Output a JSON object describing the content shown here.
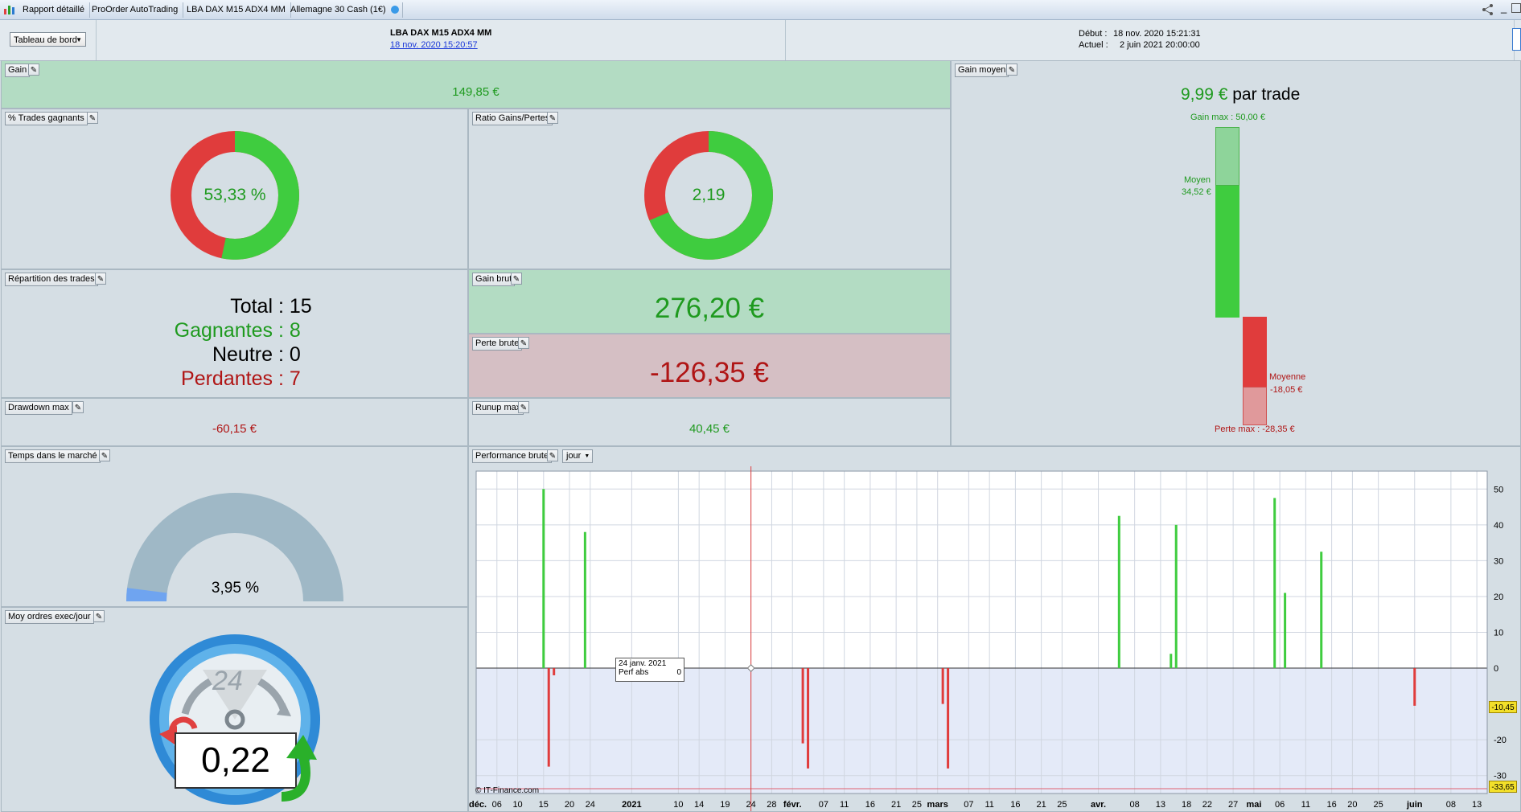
{
  "tabs": [
    {
      "label": "Rapport détaillé"
    },
    {
      "label": "ProOrder AutoTrading"
    },
    {
      "label": "LBA DAX M15 ADX4 MM"
    },
    {
      "label": "Allemagne 30 Cash (1€)"
    }
  ],
  "header": {
    "dashboard_select": "Tableau de bord",
    "strategy_name": "LBA DAX M15 ADX4 MM",
    "strategy_date_link": "18 nov. 2020 15:20:57",
    "debut_label": "Début :",
    "debut_value": "18 nov. 2020 15:21:31",
    "actuel_label": "Actuel :",
    "actuel_value": "2 juin 2021 20:00:00"
  },
  "gain": {
    "title": "Gain",
    "value": "149,85 €"
  },
  "gain_moyen": {
    "title": "Gain moyen",
    "value": "9,99 €",
    "suffix": "par trade",
    "gain_max_label": "Gain max : 50,00 €",
    "moyen_label": "Moyen",
    "moyen_value": "34,52 €",
    "moyenne_label": "Moyenne",
    "moyenne_value": "-18,05 €",
    "perte_max_label": "Perte max : -28,35 €"
  },
  "trades_gagnants": {
    "title": "% Trades gagnants",
    "value": "53,33 %",
    "win_pct": 53.33
  },
  "ratio": {
    "title": "Ratio Gains/Pertes",
    "value": "2,19",
    "win_fraction": 0.686
  },
  "repartition": {
    "title": "Répartition des trades",
    "total_label": "Total",
    "total_value": "15",
    "gagnantes_label": "Gagnantes",
    "gagnantes_value": "8",
    "neutre_label": "Neutre",
    "neutre_value": "0",
    "perdantes_label": "Perdantes",
    "perdantes_value": "7"
  },
  "gain_brut": {
    "title": "Gain brut",
    "value": "276,20 €"
  },
  "perte_brute": {
    "title": "Perte brute",
    "value": "-126,35 €"
  },
  "drawdown": {
    "title": "Drawdown max",
    "value": "-60,15 €"
  },
  "runup": {
    "title": "Runup max",
    "value": "40,45 €"
  },
  "temps_marche": {
    "title": "Temps dans le marché",
    "value": "3,95 %",
    "pct": 3.95
  },
  "moy_ordres": {
    "title": "Moy ordres exec/jour",
    "value": "0,22",
    "clock_number": "24"
  },
  "performance": {
    "title": "Performance brute",
    "period": "jour",
    "copyright": "© IT-Finance.com",
    "tooltip_date": "24 janv. 2021",
    "tooltip_label": "Perf abs",
    "tooltip_value": "0",
    "badge_1": "-10,45",
    "badge_2": "-33,65"
  },
  "colors": {
    "green": "#3fcc3f",
    "red": "#e03c3c",
    "gauge": "#9fb8c6",
    "gauge_fill": "#6fa4f0"
  },
  "chart_data": {
    "type": "bar",
    "title": "Performance brute",
    "ylim": [
      -35,
      55
    ],
    "yticks": [
      50,
      40,
      30,
      20,
      10,
      0,
      -20,
      -30
    ],
    "xlim": [
      "2020-12-02",
      "2021-06-15"
    ],
    "x_tick_labels": [
      {
        "date": "2020-12-01",
        "label": "déc.",
        "bold": true
      },
      {
        "date": "2020-12-06",
        "label": "06"
      },
      {
        "date": "2020-12-10",
        "label": "10"
      },
      {
        "date": "2020-12-15",
        "label": "15"
      },
      {
        "date": "2020-12-20",
        "label": "20"
      },
      {
        "date": "2020-12-24",
        "label": "24"
      },
      {
        "date": "2021-01-01",
        "label": "2021",
        "bold": true
      },
      {
        "date": "2021-01-10",
        "label": "10"
      },
      {
        "date": "2021-01-14",
        "label": "14"
      },
      {
        "date": "2021-01-19",
        "label": "19"
      },
      {
        "date": "2021-01-24",
        "label": "24"
      },
      {
        "date": "2021-01-28",
        "label": "28"
      },
      {
        "date": "2021-02-01",
        "label": "févr.",
        "bold": true
      },
      {
        "date": "2021-02-07",
        "label": "07"
      },
      {
        "date": "2021-02-11",
        "label": "11"
      },
      {
        "date": "2021-02-16",
        "label": "16"
      },
      {
        "date": "2021-02-21",
        "label": "21"
      },
      {
        "date": "2021-02-25",
        "label": "25"
      },
      {
        "date": "2021-03-01",
        "label": "mars",
        "bold": true
      },
      {
        "date": "2021-03-07",
        "label": "07"
      },
      {
        "date": "2021-03-11",
        "label": "11"
      },
      {
        "date": "2021-03-16",
        "label": "16"
      },
      {
        "date": "2021-03-21",
        "label": "21"
      },
      {
        "date": "2021-03-25",
        "label": "25"
      },
      {
        "date": "2021-04-01",
        "label": "avr.",
        "bold": true
      },
      {
        "date": "2021-04-08",
        "label": "08"
      },
      {
        "date": "2021-04-13",
        "label": "13"
      },
      {
        "date": "2021-04-18",
        "label": "18"
      },
      {
        "date": "2021-04-22",
        "label": "22"
      },
      {
        "date": "2021-04-27",
        "label": "27"
      },
      {
        "date": "2021-05-01",
        "label": "mai",
        "bold": true
      },
      {
        "date": "2021-05-06",
        "label": "06"
      },
      {
        "date": "2021-05-11",
        "label": "11"
      },
      {
        "date": "2021-05-16",
        "label": "16"
      },
      {
        "date": "2021-05-20",
        "label": "20"
      },
      {
        "date": "2021-05-25",
        "label": "25"
      },
      {
        "date": "2021-06-01",
        "label": "juin",
        "bold": true
      },
      {
        "date": "2021-06-08",
        "label": "08"
      },
      {
        "date": "2021-06-13",
        "label": "13"
      }
    ],
    "series": [
      {
        "values": [
          {
            "x": "2020-12-15",
            "y": 50
          },
          {
            "x": "2020-12-16",
            "y": -27.5
          },
          {
            "x": "2020-12-17",
            "y": -2
          },
          {
            "x": "2020-12-23",
            "y": 38
          },
          {
            "x": "2021-02-03",
            "y": -21
          },
          {
            "x": "2021-02-04",
            "y": -28
          },
          {
            "x": "2021-02-29",
            "y": 0
          },
          {
            "x": "2021-03-02",
            "y": -10
          },
          {
            "x": "2021-03-03",
            "y": -28
          },
          {
            "x": "2021-04-05",
            "y": 42.5
          },
          {
            "x": "2021-04-15",
            "y": 4
          },
          {
            "x": "2021-04-16",
            "y": 40
          },
          {
            "x": "2021-05-05",
            "y": 47.5
          },
          {
            "x": "2021-05-07",
            "y": 21
          },
          {
            "x": "2021-05-14",
            "y": 32.5
          },
          {
            "x": "2021-06-01",
            "y": -10.5
          }
        ]
      }
    ]
  }
}
